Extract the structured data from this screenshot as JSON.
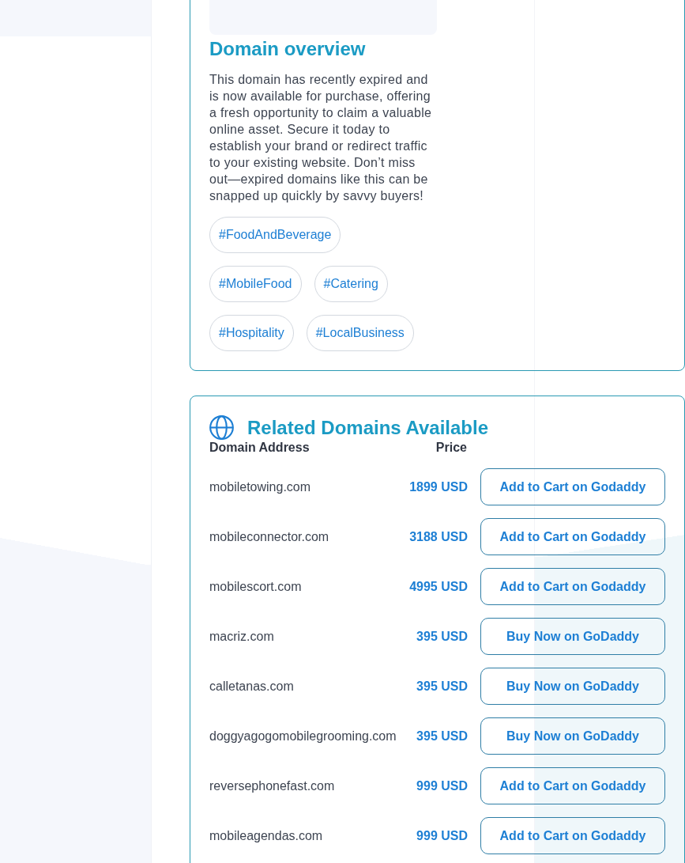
{
  "overview": {
    "title": "Domain overview",
    "description": "This domain has recently expired and is now available for purchase, offering a fresh opportunity to claim a valuable online asset. Secure it today to establish your brand or redirect traffic to your existing website. Don’t miss out—expired domains like this can be snapped up quickly by savvy buyers!",
    "tags": [
      "#FoodAndBeverage",
      "#MobileFood",
      "#Catering",
      "#Hospitality",
      "#LocalBusiness"
    ]
  },
  "related": {
    "title": "Related Domains Available",
    "columns": [
      "Domain Address",
      "Price"
    ],
    "rows": [
      {
        "domain": "mobiletowing.com",
        "price": "1899 USD",
        "action": "Add to Cart on Godaddy"
      },
      {
        "domain": "mobileconnector.com",
        "price": "3188 USD",
        "action": "Add to Cart on Godaddy"
      },
      {
        "domain": "mobilescort.com",
        "price": "4995 USD",
        "action": "Add to Cart on Godaddy"
      },
      {
        "domain": "macriz.com",
        "price": "395 USD",
        "action": "Buy Now on GoDaddy"
      },
      {
        "domain": "calletanas.com",
        "price": "395 USD",
        "action": "Buy Now on GoDaddy"
      },
      {
        "domain": "doggyagogomobilegrooming.com",
        "price": "395 USD",
        "action": "Buy Now on GoDaddy"
      },
      {
        "domain": "reversephonefast.com",
        "price": "999 USD",
        "action": "Add to Cart on Godaddy"
      },
      {
        "domain": "mobileagendas.com",
        "price": "999 USD",
        "action": "Add to Cart on Godaddy"
      }
    ]
  }
}
